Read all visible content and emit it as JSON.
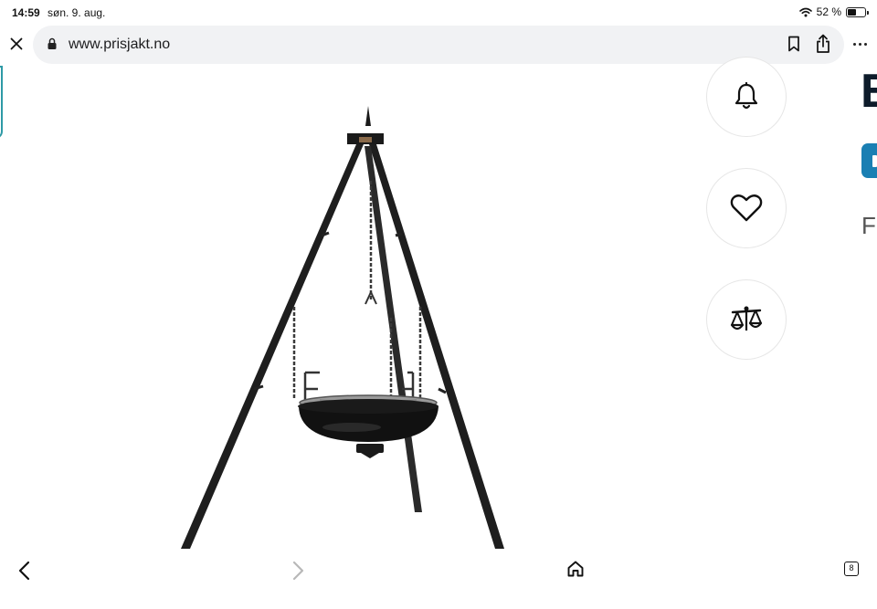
{
  "status": {
    "time": "14:59",
    "date": "søn. 9. aug.",
    "battery": "52 %"
  },
  "browser": {
    "url": "www.prisjakt.no",
    "tab_count": "8"
  },
  "page": {
    "product_image_alt": "",
    "actions": [
      {
        "name": "price-alert",
        "icon": "bell-icon"
      },
      {
        "name": "favorite",
        "icon": "heart-icon"
      },
      {
        "name": "compare",
        "icon": "scale-icon"
      }
    ],
    "cut_heading": "E",
    "cut_text": "F"
  },
  "colors": {
    "accent": "#1a7fb3",
    "teal_edge": "#2e9aa6",
    "heading": "#0d1b2a"
  }
}
